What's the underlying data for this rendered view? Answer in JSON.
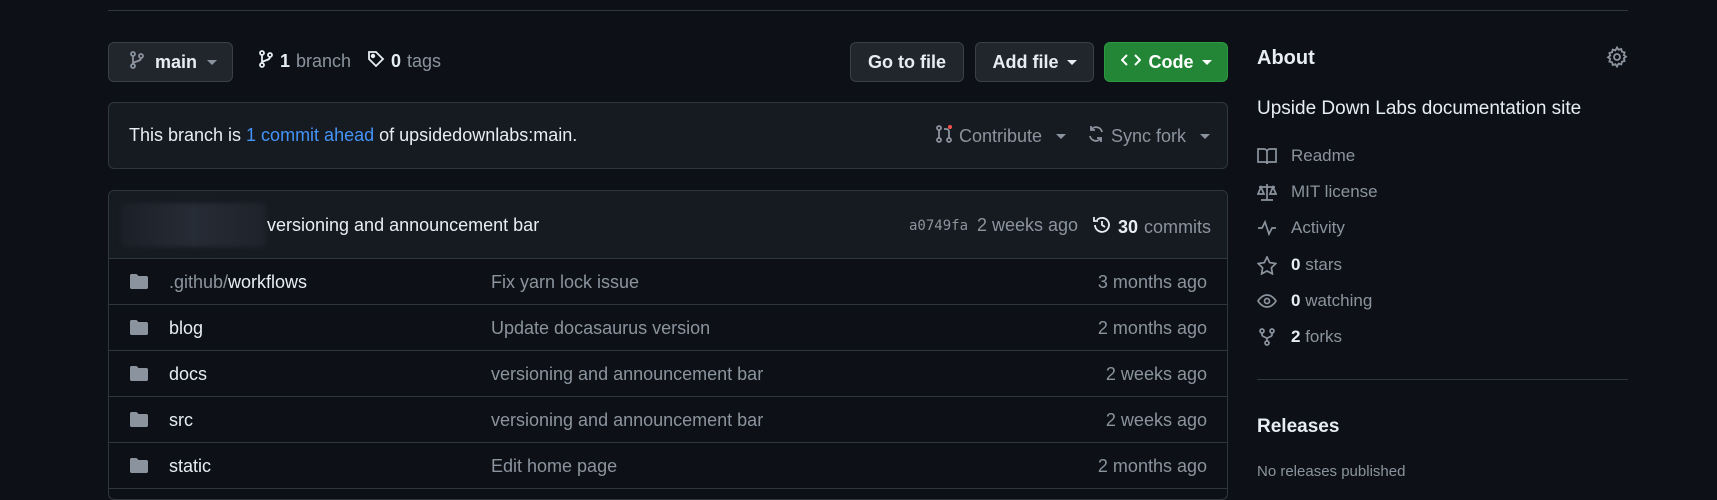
{
  "toolbar": {
    "branch_name": "main",
    "branch_count": "1",
    "branch_label": "branch",
    "tag_count": "0",
    "tag_label": "tags",
    "goto_file": "Go to file",
    "add_file": "Add file",
    "code": "Code"
  },
  "ahead": {
    "prefix": "This branch is ",
    "link": "1 commit ahead",
    "suffix": " of upsidedownlabs:main.",
    "contribute": "Contribute",
    "sync_fork": "Sync fork"
  },
  "latest_commit": {
    "message": "versioning and announcement bar",
    "hash": "a0749fa",
    "time": "2 weeks ago",
    "count": "30",
    "count_label": "commits"
  },
  "files": [
    {
      "dir_prefix": ".github/",
      "name": "workflows",
      "message": "Fix yarn lock issue",
      "time": "3 months ago"
    },
    {
      "dir_prefix": "",
      "name": "blog",
      "message": "Update docasaurus version",
      "time": "2 months ago"
    },
    {
      "dir_prefix": "",
      "name": "docs",
      "message": "versioning and announcement bar",
      "time": "2 weeks ago"
    },
    {
      "dir_prefix": "",
      "name": "src",
      "message": "versioning and announcement bar",
      "time": "2 weeks ago"
    },
    {
      "dir_prefix": "",
      "name": "static",
      "message": "Edit home page",
      "time": "2 months ago"
    }
  ],
  "about": {
    "title": "About",
    "description": "Upside Down Labs documentation site",
    "readme": "Readme",
    "license": "MIT license",
    "activity": "Activity",
    "stars_count": "0",
    "stars_label": "stars",
    "watching_count": "0",
    "watching_label": "watching",
    "forks_count": "2",
    "forks_label": "forks"
  },
  "releases": {
    "title": "Releases",
    "empty": "No releases published"
  },
  "colors": {
    "background": "#0d1117",
    "accent_link": "#4493f8",
    "code_button": "#238636"
  }
}
